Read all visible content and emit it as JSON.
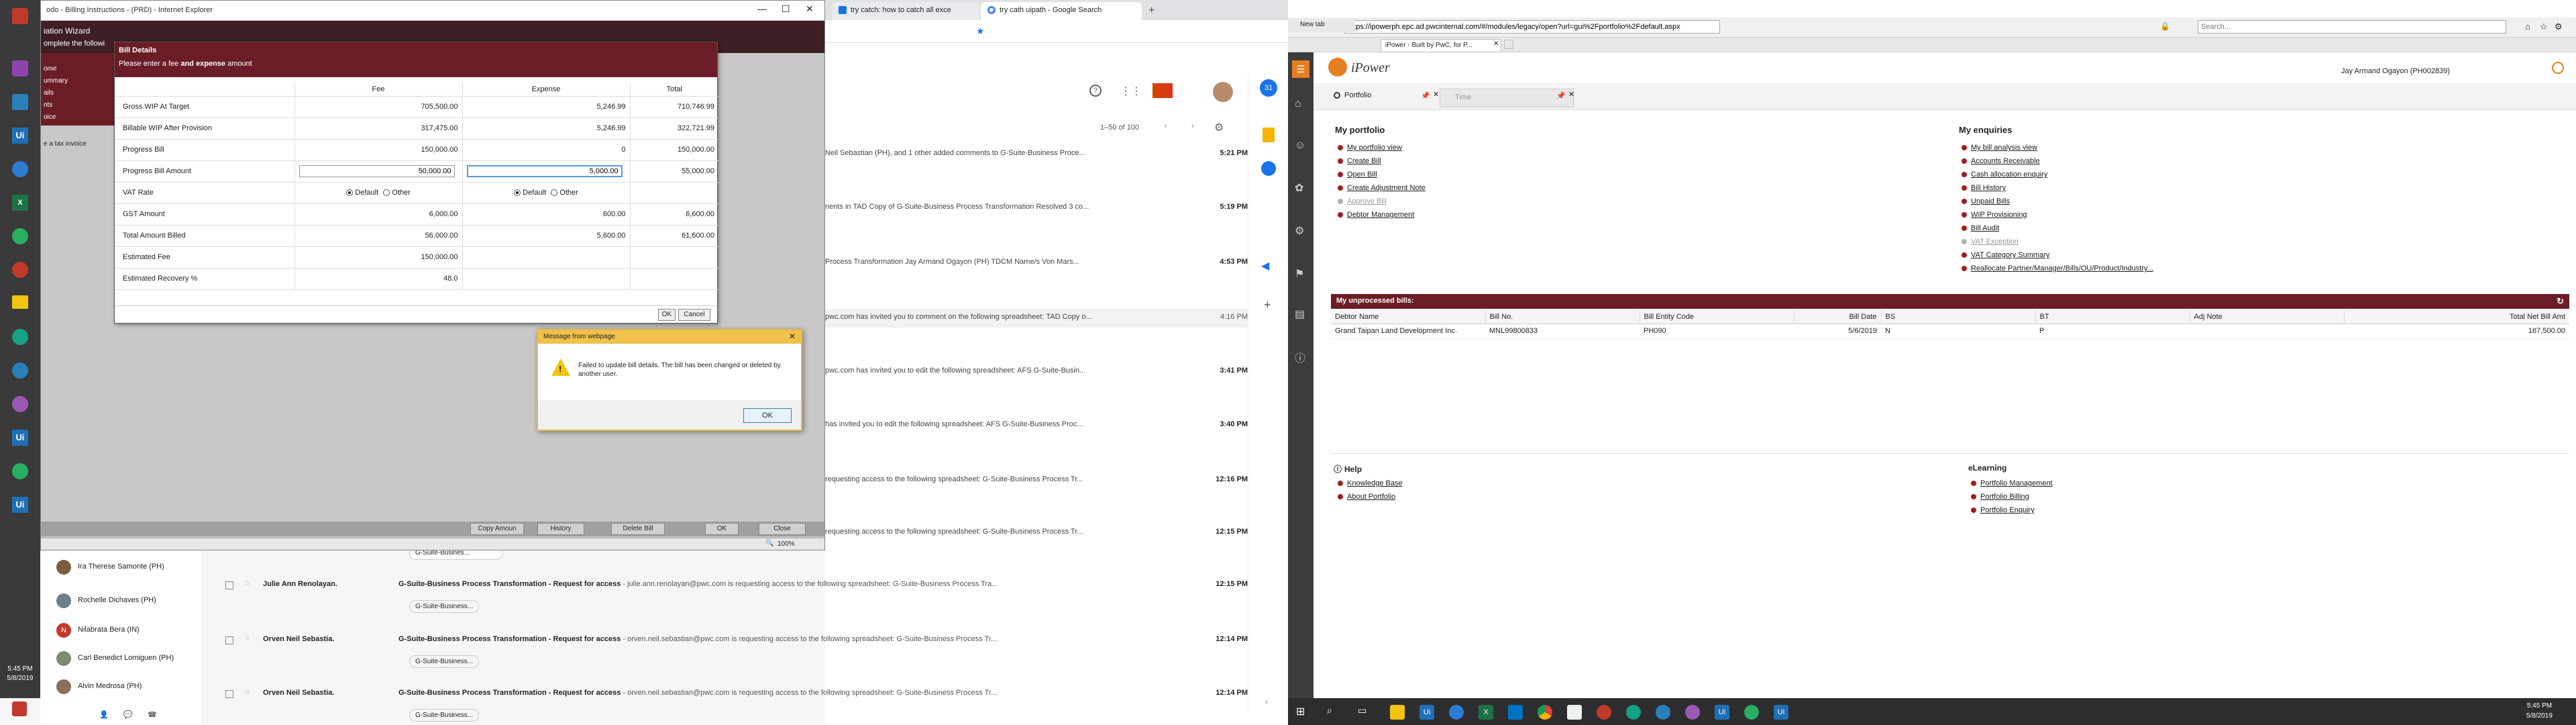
{
  "left_taskbar": {
    "time": "5:45 PM",
    "date": "5/8/2019"
  },
  "ie_window": {
    "title": "odo - Billing Instructions - (PRD) - Internet Explorer",
    "wizard_title": "iation Wizard",
    "wizard_sub": "omplete the followi",
    "side_items": [
      "ome",
      "ummary",
      "ails",
      "nts",
      "oice"
    ],
    "fax_label": "e a tax invoice",
    "bottom_buttons": [
      "Copy Amoun",
      "History",
      "Delete Bill",
      "OK",
      "Close"
    ],
    "zoom": "100%"
  },
  "bill_dialog": {
    "title": "Bill Details",
    "subtitle_prefix": "Please enter a fee ",
    "subtitle_bold": "and expense",
    "subtitle_suffix": " amount",
    "columns": [
      "",
      "Fee",
      "Expense",
      "Total"
    ],
    "rows": [
      {
        "label": "Gross WIP At Target",
        "fee": "705,500.00",
        "expense": "5,246.99",
        "total": "710,746.99"
      },
      {
        "label": "Billable WIP After Provision",
        "fee": "317,475.00",
        "expense": "5,246.99",
        "total": "322,721.99"
      },
      {
        "label": "Progress Bill",
        "fee": "150,000.00",
        "expense": "0",
        "total": "150,000.00"
      },
      {
        "label": "Progress Bill Amount",
        "fee": "50,000.00",
        "expense": "5,000.00",
        "total": "55,000.00"
      },
      {
        "label": "VAT Rate",
        "fee": "",
        "expense": "",
        "total": ""
      },
      {
        "label": "GST Amount",
        "fee": "6,000.00",
        "expense": "600.00",
        "total": "6,600.00"
      },
      {
        "label": "Total Amount Billed",
        "fee": "56,000.00",
        "expense": "5,600.00",
        "total": "61,600.00"
      },
      {
        "label": "Estimated Fee",
        "fee": "150,000.00",
        "expense": "",
        "total": ""
      },
      {
        "label": "Estimated Recovery %",
        "fee": "48.0",
        "expense": "",
        "total": ""
      }
    ],
    "vat_default": "Default",
    "vat_other": "Other",
    "ok": "OK",
    "cancel": "Cancel"
  },
  "message_box": {
    "title": "Message from webpage",
    "text": "Failed to update bill details. The bill has been changed or deleted by another user.",
    "ok": "OK"
  },
  "chrome_tabs": [
    {
      "label": "try catch: how to catch all exce"
    },
    {
      "label": "try cath uipath - Google Search"
    }
  ],
  "gmail": {
    "pagination": "1–50 of 100",
    "snippets": [
      {
        "text": "Neil Sebastian (PH), and 1 other added comments to G-Suite-Business Proce...",
        "time": "5:21 PM"
      },
      {
        "text": "nents in TAD Copy of G-Suite-Business Process Transformation Resolved 3 co...",
        "time": "5:19 PM"
      },
      {
        "text": "Process Transformation Jay Armand Ogayon (PH) TDCM Name/s Von Mars...",
        "time": "4:53 PM"
      },
      {
        "text": "pwc.com has invited you to comment on the following spreadsheet: TAD Copy o...",
        "time": "4:16 PM"
      },
      {
        "text": "pwc.com has invited you to edit the following spreadsheet: AFS G-Suite-Busin...",
        "time": "3:41 PM"
      },
      {
        "text": "has invited you to edit the following spreadsheet: AFS G-Suite-Business Proc...",
        "time": "3:40 PM"
      },
      {
        "text": "requesting access to the following spreadsheet: G-Suite-Business Process Tr...",
        "time": "12:16 PM"
      },
      {
        "text": "requesting access to the following spreadsheet: G-Suite-Business Process Tr...",
        "time": "12:15 PM"
      }
    ],
    "full_rows": [
      {
        "sender": "Julie Ann Renolayan.",
        "subject": "G-Suite-Business Process Transformation - Request for access",
        "snippet": " - julie.ann.renolayan@pwc.com is requesting access to the following spreadsheet: G-Suite-Business Process Tra...",
        "time": "12:15 PM",
        "chip": "G-Suite-Business..."
      },
      {
        "sender": "Orven Neil Sebastia.",
        "subject": "G-Suite-Business Process Transformation - Request for access",
        "snippet": " - orven.neil.sebastian@pwc.com is requesting access to the following spreadsheet: G-Suite-Business Process Tr...",
        "time": "12:14 PM",
        "chip": "G-Suite-Business..."
      },
      {
        "sender": "Orven Neil Sebastia.",
        "subject": "G-Suite-Business Process Transformation - Request for access",
        "snippet": " - orven.neil.sebastian@pwc.com is requesting access to the following spreadsheet: G-Suite-Business Process Tr...",
        "time": "12:14 PM",
        "chip": "G-Suite-Business..."
      }
    ],
    "top_chip": "G-Suite-Busines...",
    "contacts": [
      {
        "name": "Ira Therese Samonte (PH)",
        "initial": "I",
        "color": "#7a5c3e"
      },
      {
        "name": "Rochelle Dichaves (PH)",
        "initial": "R",
        "color": "#6b7f8c"
      },
      {
        "name": "Nilabrata Bera (IN)",
        "initial": "N",
        "color": "#c0392b"
      },
      {
        "name": "Carl Benedict Lomiguen (PH)",
        "initial": "C",
        "color": "#7b8d6b"
      },
      {
        "name": "Alvin Medrosa (PH)",
        "initial": "A",
        "color": "#8a6f5a"
      }
    ]
  },
  "right_browser": {
    "url": "https://ipowerph.epc.ad.pwcinternal.com/#/modules/legacy/open?url=gui%2Fportfolio%2Fdefault.aspx",
    "search_placeholder": "Search...",
    "tab_label": "iPower - Built by PwC, for P...",
    "newtab_label": "New tab"
  },
  "ipower": {
    "logo": "iPower",
    "user": "Jay Armand Ogayon (PH002839)",
    "tab_portfolio": "Portfolio",
    "tab_time": "Time",
    "my_portfolio_title": "My portfolio",
    "my_portfolio": [
      {
        "label": "My portfolio view",
        "grey": false
      },
      {
        "label": "Create Bill",
        "grey": false
      },
      {
        "label": "Open Bill",
        "grey": false
      },
      {
        "label": "Create Adjustment Note",
        "grey": false
      },
      {
        "label": "Approve Bill",
        "grey": true
      },
      {
        "label": "Debtor Management",
        "grey": false
      }
    ],
    "my_enquiries_title": "My enquiries",
    "my_enquiries": [
      {
        "label": "My bill analysis view",
        "grey": false
      },
      {
        "label": "Accounts Receivable",
        "grey": false
      },
      {
        "label": "Cash allocation enquiry",
        "grey": false
      },
      {
        "label": "Bill History",
        "grey": false
      },
      {
        "label": "Unpaid Bills",
        "grey": false
      },
      {
        "label": "WIP Provisioning",
        "grey": false
      },
      {
        "label": "Bill Audit",
        "grey": false
      },
      {
        "label": "VAT Exception",
        "grey": true
      },
      {
        "label": "VAT Category Summary",
        "grey": false
      },
      {
        "label": "Reallocate Partner/Manager/Bills/OU/Product/Industry...",
        "grey": false
      }
    ],
    "unprocessed_title": "My unprocessed bills:",
    "unprocessed_columns": [
      "Debtor Name",
      "Bill No.",
      "Bill Entity Code",
      "Bill Date",
      "BS",
      "BT",
      "Adj Note",
      "Total Net Bill Amt"
    ],
    "unprocessed_rows": [
      {
        "debtor": "Grand Taipan Land Development Inc.",
        "bill_no": "MNL99800833",
        "entity": "PH090",
        "date": "5/6/2019",
        "bs": "N",
        "bt": "P",
        "adj": "",
        "total": "167,500.00"
      }
    ],
    "help_title": "Help",
    "help_items": [
      "Knowledge Base",
      "About Portfolio"
    ],
    "elearning_title": "eLearning",
    "elearning_items": [
      "Portfolio Management",
      "Portfolio Billing",
      "Portfolio Enquiry"
    ]
  },
  "right_taskbar": {
    "time": "5:45 PM",
    "date": "5/8/2019"
  }
}
